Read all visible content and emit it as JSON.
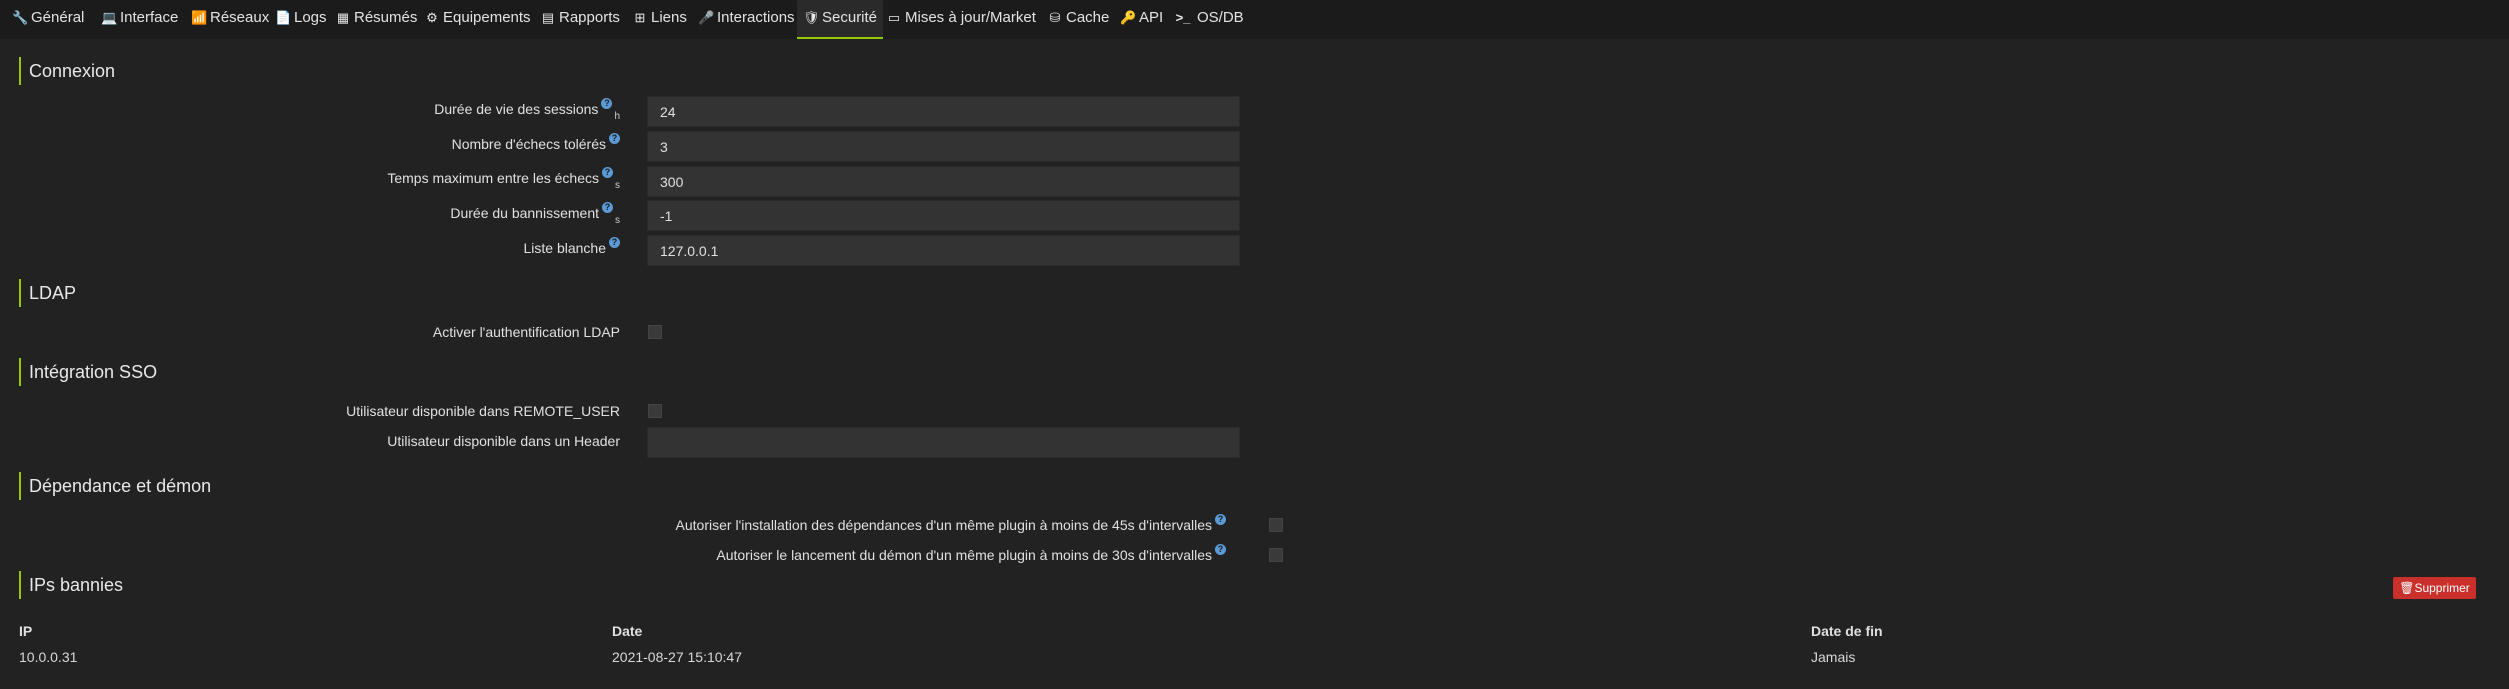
{
  "tabs": [
    {
      "label": "Général",
      "icon": "wrench-icon",
      "glyph": "🔧"
    },
    {
      "label": "Interface",
      "icon": "laptop-icon",
      "glyph": "💻"
    },
    {
      "label": "Réseaux",
      "icon": "rss-icon",
      "glyph": "📶"
    },
    {
      "label": "Logs",
      "icon": "file-icon",
      "glyph": "📄"
    },
    {
      "label": "Résumés",
      "icon": "table-icon",
      "glyph": "▦"
    },
    {
      "label": "Equipements",
      "icon": "cogs-icon",
      "glyph": "⚙"
    },
    {
      "label": "Rapports",
      "icon": "newspaper-icon",
      "glyph": "▤"
    },
    {
      "label": "Liens",
      "icon": "sitemap-icon",
      "glyph": "⊞"
    },
    {
      "label": "Interactions",
      "icon": "microphone-icon",
      "glyph": "🎤"
    },
    {
      "label": "Securité",
      "icon": "shield-icon",
      "glyph": "🛡"
    },
    {
      "label": "Mises à jour/Market",
      "icon": "credit-card-icon",
      "glyph": "▭"
    },
    {
      "label": "Cache",
      "icon": "hdd-icon",
      "glyph": "⛁"
    },
    {
      "label": "API",
      "icon": "key-icon",
      "glyph": "🔑"
    },
    {
      "label": "OS/DB",
      "icon": "terminal-icon",
      "glyph": ">_"
    }
  ],
  "sections": {
    "connexion": "Connexion",
    "ldap": "LDAP",
    "sso": "Intégration SSO",
    "dependance": "Dépendance et démon",
    "ips": "IPs bannies"
  },
  "connexion": {
    "session_label": "Durée de vie des sessions",
    "session_unit": "h",
    "session_value": "24",
    "echecs_label": "Nombre d'échecs tolérés",
    "echecs_value": "3",
    "temps_label": "Temps maximum entre les échecs",
    "temps_unit": "s",
    "temps_value": "300",
    "ban_label": "Durée du bannissement",
    "ban_unit": "s",
    "ban_value": "-1",
    "whitelist_label": "Liste blanche",
    "whitelist_value": "127.0.0.1"
  },
  "ldap": {
    "enable_label": "Activer l'authentification LDAP"
  },
  "sso": {
    "remote_user_label": "Utilisateur disponible dans REMOTE_USER",
    "header_label": "Utilisateur disponible dans un Header",
    "header_value": ""
  },
  "dependance": {
    "install_label": "Autoriser l'installation des dépendances d'un même plugin à moins de 45s d'intervalles",
    "daemon_label": "Autoriser le lancement du démon d'un même plugin à moins de 30s d'intervalles"
  },
  "help_glyph": "?",
  "ips": {
    "delete_label": "Supprimer",
    "delete_glyph": "🗑",
    "headers": [
      "IP",
      "Date",
      "Date de fin"
    ],
    "rows": [
      [
        "10.0.0.31",
        "2021-08-27 15:10:47",
        "Jamais"
      ]
    ]
  },
  "colors": {
    "accent": "#94ca02",
    "danger": "#c9302c",
    "help": "#5a9bd5"
  }
}
